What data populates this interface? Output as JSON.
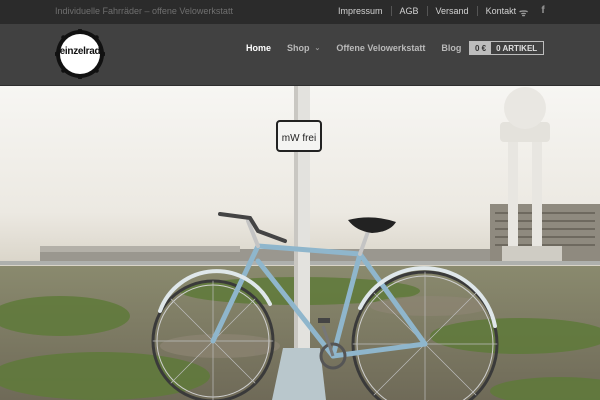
{
  "site": {
    "tagline": "Individuelle Fahrräder – offene Velowerkstatt",
    "logo_text": "einzelrad"
  },
  "toplinks": [
    {
      "label": "Impressum"
    },
    {
      "label": "AGB"
    },
    {
      "label": "Versand"
    },
    {
      "label": "Kontakt"
    }
  ],
  "social": {
    "rss": "rss-icon",
    "facebook": "facebook-icon",
    "rss_glyph": "ᯤ",
    "facebook_glyph": "f"
  },
  "nav": [
    {
      "label": "Home",
      "active": true
    },
    {
      "label": "Shop",
      "has_dropdown": true
    },
    {
      "label": "Offene Velowerkstatt"
    },
    {
      "label": "Blog"
    }
  ],
  "cart": {
    "price": "0 €",
    "count": "0 ARTIKEL"
  },
  "hero": {
    "sign_text": "mW frei"
  },
  "colors": {
    "topbar": "#2b2b2b",
    "header": "#414141",
    "nav_active": "#ffffff",
    "nav_text": "#b9b9b9",
    "bike_frame": "#8fb6cc"
  }
}
